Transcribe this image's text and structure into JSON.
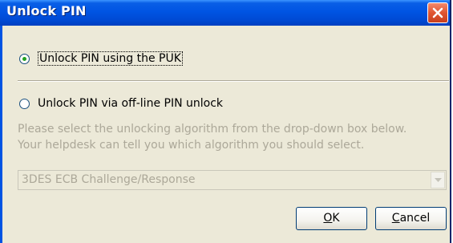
{
  "window": {
    "title": "Unlock PIN"
  },
  "options": {
    "puk_label": "Unlock PIN using the PUK",
    "puk_selected": true,
    "offline_label": "Unlock PIN via off-line PIN unlock",
    "offline_selected": false
  },
  "help": {
    "line1": "Please select the unlocking algorithm from the drop-down box below.",
    "line2": "Your helpdesk can tell you which algorithm you should select."
  },
  "algorithm": {
    "selected": "3DES ECB Challenge/Response",
    "enabled": false
  },
  "buttons": {
    "ok_mnemonic": "O",
    "ok_rest": "K",
    "cancel_mnemonic": "C",
    "cancel_rest": "ancel"
  },
  "icons": {
    "close": "close-icon",
    "dropdown": "chevron-down-icon"
  }
}
